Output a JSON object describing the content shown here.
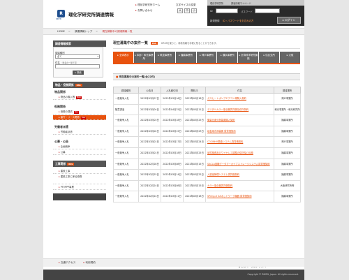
{
  "header": {
    "logo_text": "R",
    "logo_sub": "RIKEN",
    "site_title": "理化学研究所調達情報",
    "link_home": "理化学研究所ホーム",
    "link_contact": "お問い合わせ",
    "font_size_label": "文字サイズの変更",
    "font_sizes": [
      "大",
      "中",
      "小"
    ]
  },
  "login": {
    "tab1": "理化学研究所",
    "tab2": "調達情報マイページ",
    "id_label": "ID",
    "pw_label": "パスワード",
    "register": "新規登録",
    "forgot": "ID・パスワードをお忘れの方",
    "button": "▸ ログイン"
  },
  "breadcrumb": [
    "HOME",
    "調達情報トップ",
    "現在募集中の調達情報一覧"
  ],
  "sidebar": {
    "search_header": "調達情報検索",
    "search_rss": "RSS",
    "type_label": "調達種別",
    "type_value": "全て",
    "name_label": "件名",
    "name_hint": "（件名の一部で可）",
    "search_button": "▸ 検索",
    "goods_header": "物品・役務関係",
    "goods_rss": "RSS",
    "goods_section": "物品関係",
    "goods_items": [
      {
        "label": "物品の購入等",
        "new": "New"
      }
    ],
    "service_section": "役務関係",
    "service_items": [
      {
        "label": "役務の提供",
        "new": "New"
      },
      {
        "label": "保守・リース関係",
        "new": "New"
      }
    ],
    "labor_section": "労働者派遣",
    "labor_items": [
      {
        "label": "労働者派遣",
        "new": ""
      }
    ],
    "public_section": "公募・公告",
    "public_items": [
      {
        "label": "企画競争",
        "new": ""
      },
      {
        "label": "公募",
        "new": ""
      }
    ],
    "works_header": "工事関係",
    "works_rss": "RSS",
    "works_items": [
      {
        "label": "建設工事",
        "new": ""
      },
      {
        "label": "建設工事に係る役務",
        "new": ""
      },
      {
        "label": "PFI/PPP事業",
        "new": ""
      }
    ]
  },
  "main": {
    "title": "現在募集中の案件一覧",
    "rss": "RSS",
    "note": "※RSSを使うと、新着情報を手軽に知ることができます。",
    "tabs": [
      {
        "label": "全体表示",
        "active": true
      },
      {
        "label": "本部・和光事業所",
        "active": false
      },
      {
        "label": "筑波事業所",
        "active": false
      },
      {
        "label": "播磨事業所",
        "active": false
      },
      {
        "label": "神戸事業所",
        "active": false
      },
      {
        "label": "横浜事業所",
        "active": false
      },
      {
        "label": "計算科学研究機構",
        "active": false
      },
      {
        "label": "仙台支所",
        "active": false
      },
      {
        "label": "大阪",
        "active": false
      }
    ],
    "list_title": "現在募集中の案件一覧(全22件)",
    "columns": [
      "調達種別",
      "公告日",
      "入札締切日",
      "開札日",
      "件名",
      "調達場所"
    ],
    "rows": [
      {
        "type": "一般競争入札",
        "notice": "2022年03月07日",
        "deadline": "2022年03月16日",
        "open": "2022年03月18日",
        "name": "ガスヒートポンプエアコン等購入契約",
        "place": "神戸事業所"
      },
      {
        "type": "随意調達",
        "notice": "2022年03月04日",
        "deadline": "2022年04月25日",
        "open": "2022年05月11日",
        "name": "デジタルカラー複合機賃貸借及保守契約",
        "place": "和光事業所・和光研究所"
      },
      {
        "type": "一般競争入札",
        "notice": "2022年03月03日",
        "deadline": "2022年03月18日",
        "open": "2022年03月25日",
        "name": "微量元素分析装置購入契約",
        "place": "播磨事業所"
      },
      {
        "type": "一般競争入札",
        "notice": "2022年03月02日",
        "deadline": "2022年03月15日",
        "open": "2022年03月23日",
        "name": "培養用冷却装置 賃貸借契約",
        "place": "播磨事業所"
      },
      {
        "type": "一般競争入札",
        "notice": "2022年03月01日",
        "deadline": "2022年03月17日",
        "open": "2022年03月24日",
        "name": "CO2INHV関連システム賃貸借契約",
        "place": "神戸事業所"
      },
      {
        "type": "一般競争入札",
        "notice": "2022年03月01日",
        "deadline": "2022年03月18日",
        "open": "2022年03月25日",
        "name": "品質検査及びワイヤレス調整の保守及び点検",
        "place": "播磨事業所"
      },
      {
        "type": "一般競争入札",
        "notice": "2022年02月28日",
        "deadline": "2022年03月08日",
        "open": "2022年03月15日",
        "name": "SACLA実験データアーカイブストレージシステム賃貸借契約",
        "place": "播磨事業所"
      },
      {
        "type": "一般競争入札",
        "notice": "2022年02月25日",
        "deadline": "2022年03月14日",
        "open": "2022年03月22日",
        "name": "入退室管理システム賃貸借契約",
        "place": "播磨事業所"
      },
      {
        "type": "一般競争入札",
        "notice": "2022年02月24日",
        "deadline": "2022年03月08日",
        "open": "2022年03月15日",
        "name": "カラー複合機賃貸借契約",
        "place": "大阪研究所等"
      },
      {
        "type": "一般競争入札",
        "notice": "2022年02月24日",
        "deadline": "2022年03月11日",
        "open": "2022年03月18日",
        "name": "SPring-8 OAネットワーク機器 賃貸借契約",
        "place": "播磨事業所"
      }
    ],
    "next_page": "次のページ",
    "back_top": "このページのトップへ"
  },
  "footer": {
    "links": [
      "交通アクセス",
      "利用規約"
    ],
    "copyright": "Copyright © RIKEN, Japan. All rights reserved."
  }
}
